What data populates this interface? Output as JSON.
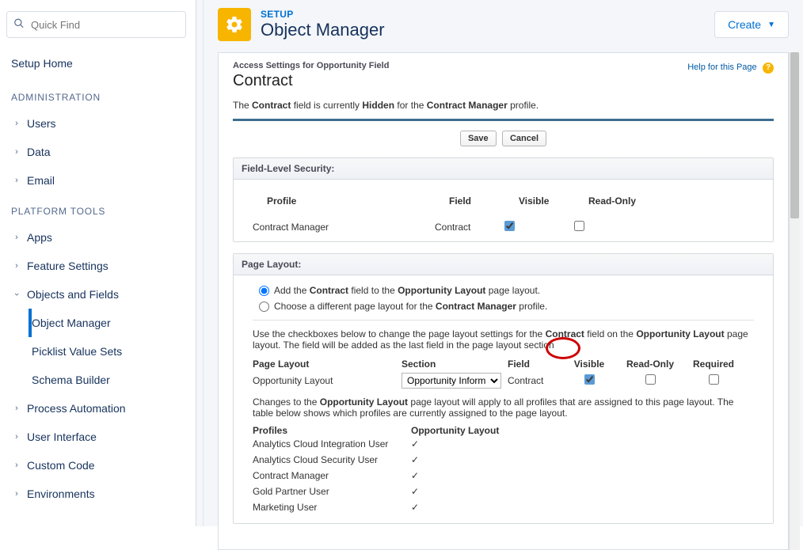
{
  "sidebar": {
    "quickfind_placeholder": "Quick Find",
    "setup_home": "Setup Home",
    "sections": {
      "admin_title": "ADMINISTRATION",
      "admin_items": [
        "Users",
        "Data",
        "Email"
      ],
      "platform_title": "PLATFORM TOOLS",
      "platform_items": [
        "Apps",
        "Feature Settings"
      ],
      "objects_fields": "Objects and Fields",
      "objects_subs": [
        "Object Manager",
        "Picklist Value Sets",
        "Schema Builder"
      ],
      "platform_rest": [
        "Process Automation",
        "User Interface",
        "Custom Code",
        "Environments"
      ]
    }
  },
  "header": {
    "eyebrow": "SETUP",
    "title": "Object Manager",
    "create_label": "Create"
  },
  "classic": {
    "breadcrumb": "Access Settings for Opportunity Field",
    "page_title": "Contract",
    "help_label": "Help for this Page",
    "status_prefix": "The ",
    "status_b1": "Contract",
    "status_mid": " field is currently ",
    "status_b2": "Hidden",
    "status_mid2": " for the ",
    "status_b3": "Contract Manager",
    "status_suffix": " profile.",
    "save_label": "Save",
    "cancel_label": "Cancel",
    "fls_header": "Field-Level Security:",
    "fls_cols": {
      "profile": "Profile",
      "field": "Field",
      "visible": "Visible",
      "readonly": "Read-Only"
    },
    "fls_row": {
      "profile": "Contract Manager",
      "field": "Contract"
    },
    "pl_header": "Page Layout:",
    "radio1_pre": "Add the ",
    "radio1_b1": "Contract",
    "radio1_mid": " field to the ",
    "radio1_b2": "Opportunity Layout",
    "radio1_post": " page layout.",
    "radio2_pre": "Choose a different page layout for the ",
    "radio2_b": "Contract Manager",
    "radio2_post": " profile.",
    "hint_pre": "Use the checkboxes below to change the page layout settings for the ",
    "hint_b1": "Contract",
    "hint_mid": " field on the ",
    "hint_b2": "Opportunity Layout",
    "hint_post": " page layout. The field will be added as the last field in the page layout section",
    "pl_cols": {
      "layout": "Page Layout",
      "section": "Section",
      "field": "Field",
      "visible": "Visible",
      "readonly": "Read-Only",
      "required": "Required"
    },
    "pl_row": {
      "layout": "Opportunity Layout",
      "section": "Opportunity Information",
      "field": "Contract"
    },
    "note_pre": "Changes to the ",
    "note_b": "Opportunity Layout",
    "note_post": " page layout will apply to all profiles that are assigned to this page layout. The table below shows which profiles are currently assigned to the page layout.",
    "profiles_head": {
      "c1": "Profiles",
      "c2": "Opportunity Layout"
    },
    "profiles": [
      "Analytics Cloud Integration User",
      "Analytics Cloud Security User",
      "Contract Manager",
      "Gold Partner User",
      "Marketing User"
    ]
  }
}
